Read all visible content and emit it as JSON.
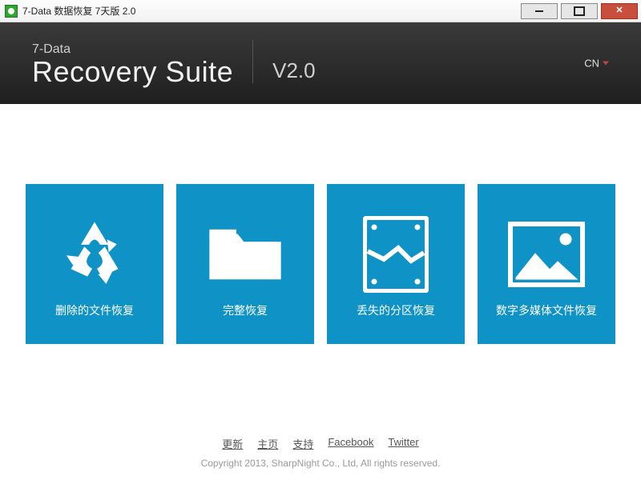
{
  "titlebar": {
    "title": "7-Data 数据恢复 7天版 2.0"
  },
  "header": {
    "brand_line1": "7-Data",
    "brand_line2": "Recovery Suite",
    "version": "V2.0",
    "language_label": "CN"
  },
  "tiles": [
    {
      "id": "deleted",
      "label": "删除的文件恢复",
      "icon": "recycle-icon"
    },
    {
      "id": "complete",
      "label": "完整恢复",
      "icon": "folder-icon"
    },
    {
      "id": "partition",
      "label": "丢失的分区恢复",
      "icon": "broken-drive-icon"
    },
    {
      "id": "media",
      "label": "数字多媒体文件恢复",
      "icon": "photo-icon"
    }
  ],
  "footer": {
    "links": [
      {
        "label": "更新"
      },
      {
        "label": "主页"
      },
      {
        "label": "支持"
      },
      {
        "label": "Facebook"
      },
      {
        "label": "Twitter"
      }
    ],
    "copyright": "Copyright 2013, SharpNight Co., Ltd, All rights reserved."
  },
  "colors": {
    "tile": "#0f93c6",
    "header_bg": "#2a2a2a",
    "close_btn": "#c94f3d"
  }
}
